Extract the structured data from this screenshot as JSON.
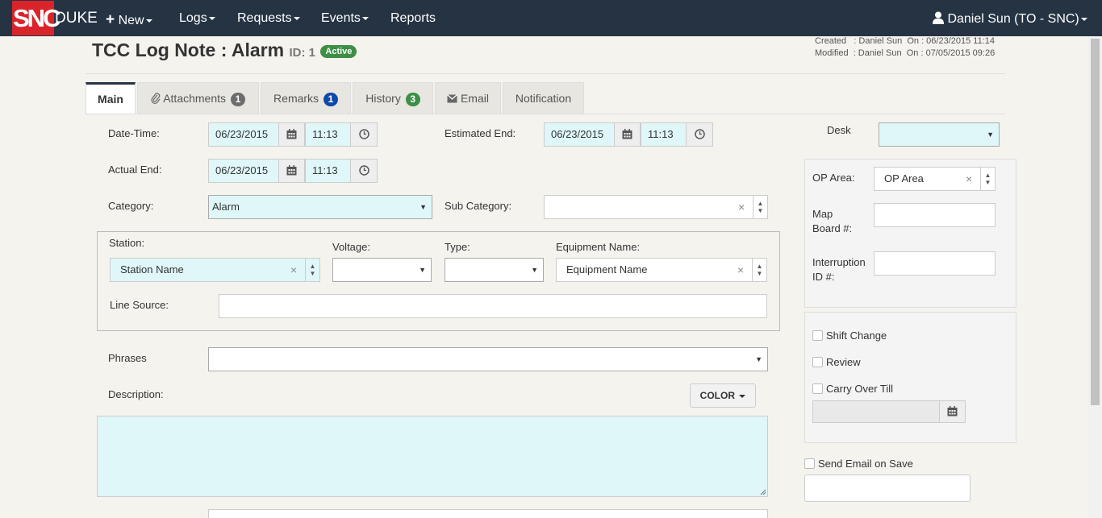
{
  "nav": {
    "logo_text": "SNC",
    "brand": "DUKE",
    "menu": {
      "new": "New",
      "logs": "Logs",
      "requests": "Requests",
      "events": "Events",
      "reports": "Reports"
    },
    "user": "Daniel Sun (TO - SNC)"
  },
  "header": {
    "title": "TCC Log Note : Alarm",
    "id_text": "ID: 1",
    "status_badge": "Active",
    "created": "Created   : Daniel Sun  On : 06/23/2015 11:14",
    "modified": "Modified  : Daniel Sun  On : 07/05/2015 09:26"
  },
  "tabs": [
    {
      "label": "Main"
    },
    {
      "label": "Attachments",
      "badge": "1"
    },
    {
      "label": "Remarks",
      "badge": "1"
    },
    {
      "label": "History",
      "badge": "3"
    },
    {
      "label": "Email"
    },
    {
      "label": "Notification"
    }
  ],
  "form": {
    "datetime": {
      "label": "Date-Time:",
      "date": "06/23/2015",
      "time": "11:13"
    },
    "estimated_end": {
      "label": "Estimated End:",
      "date": "06/23/2015",
      "time": "11:13"
    },
    "actual_end": {
      "label": "Actual End:",
      "date": "06/23/2015",
      "time": "11:13"
    },
    "category": {
      "label": "Category:",
      "value": "Alarm"
    },
    "sub_category": {
      "label": "Sub Category:",
      "value": ""
    },
    "station": {
      "label": "Station:",
      "value": "Station Name"
    },
    "voltage": {
      "label": "Voltage:",
      "value": ""
    },
    "type": {
      "label": "Type:",
      "value": ""
    },
    "equipment": {
      "label": "Equipment Name:",
      "value": "Equipment Name"
    },
    "line_source": {
      "label": "Line Source:",
      "value": ""
    },
    "phrases": {
      "label": "Phrases",
      "value": ""
    },
    "description": {
      "label": "Description:",
      "value": ""
    },
    "color_button": "COLOR"
  },
  "right": {
    "desk": {
      "label": "Desk",
      "value": ""
    },
    "op_area": {
      "label": "OP Area:",
      "value": "OP Area"
    },
    "map_board": {
      "label1": "Map",
      "label2": "Board #:",
      "value": ""
    },
    "interruption": {
      "label1": "Interruption",
      "label2": "ID #:",
      "value": ""
    },
    "shift_change": "Shift Change",
    "review": "Review",
    "carry_over": "Carry Over Till",
    "send_email": "Send Email on Save"
  },
  "colors": {
    "navbar": "#253343",
    "logo_red": "#d9242b",
    "active_green": "#3c8f44",
    "remarks_blue": "#1049a8",
    "attachments_grey": "#6d6d6d",
    "input_cyan": "#dff7f9"
  }
}
